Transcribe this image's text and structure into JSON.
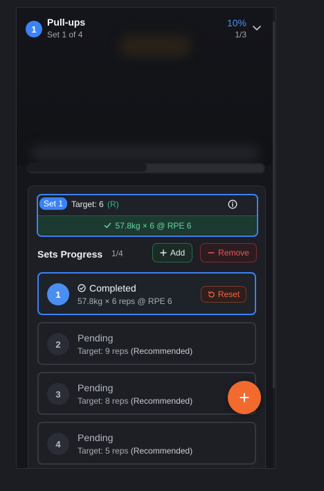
{
  "exercise": {
    "index": "1",
    "title": "Pull-ups",
    "subtitle": "Set 1 of 4",
    "percent": "10%",
    "count": "1/3"
  },
  "current_set": {
    "chip": "Set 1",
    "target_label": "Target: 6",
    "target_flag": "(R)",
    "result": "57.8kg × 6 @ RPE 6"
  },
  "sets_progress": {
    "title": "Sets Progress",
    "count": "1/4",
    "add_label": "Add",
    "remove_label": "Remove"
  },
  "sets": [
    {
      "number": "1",
      "status": "Completed",
      "detail": "57.8kg × 6 reps @ RPE 6",
      "recommended": "",
      "reset_label": "Reset"
    },
    {
      "number": "2",
      "status": "Pending",
      "detail": "Target: 9 reps",
      "recommended": "(Recommended)"
    },
    {
      "number": "3",
      "status": "Pending",
      "detail": "Target: 8 reps",
      "recommended": "(Recommended)"
    },
    {
      "number": "4",
      "status": "Pending",
      "detail": "Target: 5 reps",
      "recommended": "(Recommended)"
    }
  ],
  "fab_icon": "plus-icon",
  "colors": {
    "accent": "#3b82f6",
    "success": "#5fd8a4",
    "danger": "#e25a5a",
    "fab": "#f26a2e"
  }
}
